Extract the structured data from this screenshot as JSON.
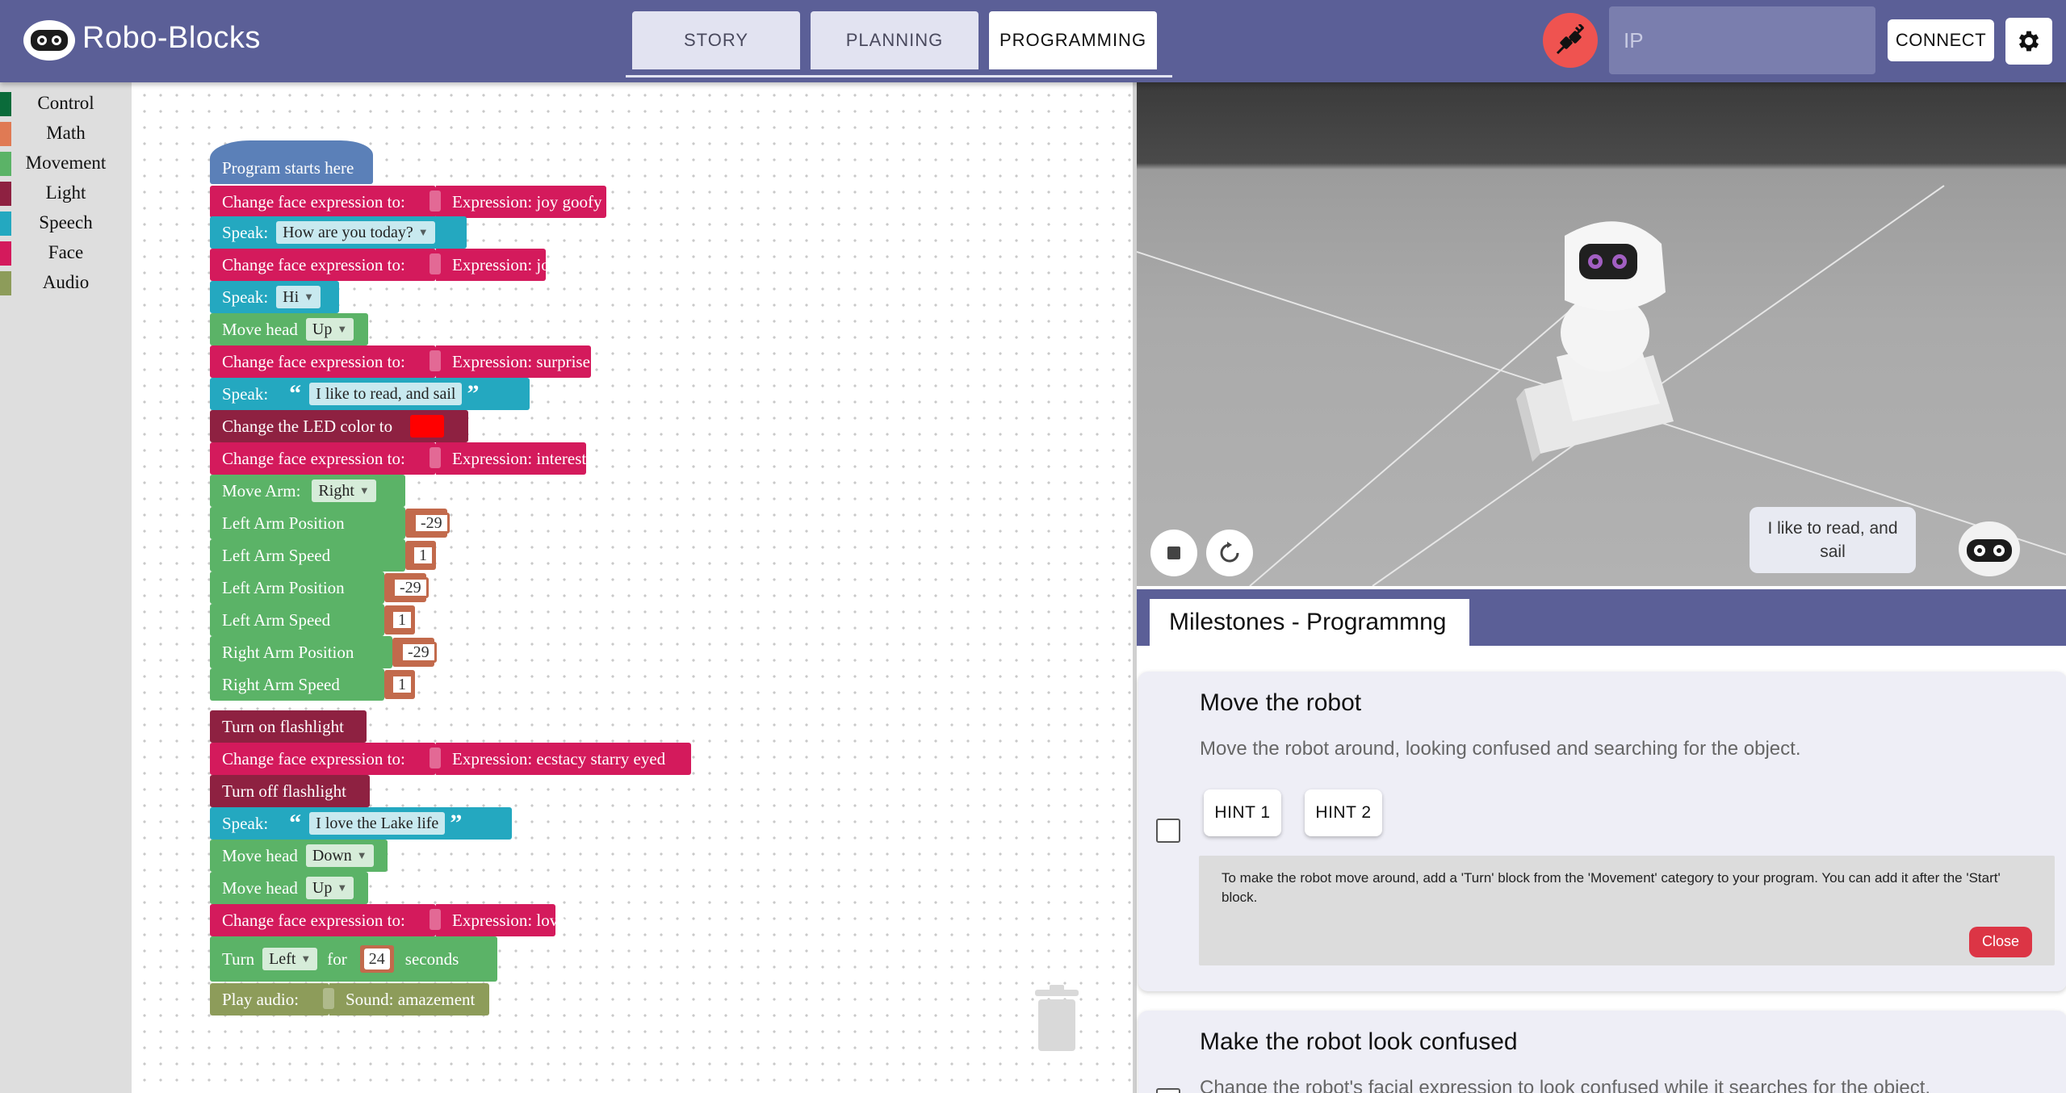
{
  "app": {
    "title": "Robo-Blocks"
  },
  "tabs": [
    {
      "label": "STORY",
      "active": false
    },
    {
      "label": "PLANNING",
      "active": false
    },
    {
      "label": "PROGRAMMING",
      "active": true
    }
  ],
  "connection": {
    "status_icon": "unplugged-icon",
    "ip_placeholder": "IP",
    "connect_label": "CONNECT",
    "settings_icon": "gear-icon"
  },
  "toolbox": {
    "categories": [
      {
        "label": "Control",
        "color": "#0a6b3a"
      },
      {
        "label": "Math",
        "color": "#e07a54"
      },
      {
        "label": "Movement",
        "color": "#5bb367"
      },
      {
        "label": "Light",
        "color": "#8e2141"
      },
      {
        "label": "Speech",
        "color": "#24a8c0"
      },
      {
        "label": "Face",
        "color": "#d41a5c"
      },
      {
        "label": "Audio",
        "color": "#8d9c5a"
      }
    ]
  },
  "program": {
    "start": "Program starts here",
    "b1": {
      "label": "Change face expression to:",
      "value": "Expression: joy goofy"
    },
    "b2": {
      "label": "Speak:",
      "value": "How are you today?"
    },
    "b3": {
      "label": "Change face expression to:",
      "value": "Expression: joy"
    },
    "b4": {
      "label": "Speak:",
      "value": "Hi"
    },
    "b5": {
      "label": "Move head",
      "value": "Up"
    },
    "b6": {
      "label": "Change face expression to:",
      "value": "Expression: surprise"
    },
    "b7": {
      "label": "Speak:",
      "value": "I like to read, and sail"
    },
    "b8": {
      "label": "Change the LED color to",
      "color": "#ff0000"
    },
    "b9": {
      "label": "Change face expression to:",
      "value": "Expression: interest"
    },
    "arm": {
      "label": "Move Arm:",
      "value": "Right",
      "params": [
        {
          "label": "Left Arm Position",
          "value": "-29"
        },
        {
          "label": "Left Arm Speed",
          "value": "1"
        },
        {
          "label": "Left Arm Position",
          "value": "-29"
        },
        {
          "label": "Left Arm Speed",
          "value": "1"
        },
        {
          "label": "Right Arm Position",
          "value": "-29"
        },
        {
          "label": "Right Arm Speed",
          "value": "1"
        }
      ]
    },
    "b10": {
      "label": "Turn on flashlight"
    },
    "b11": {
      "label": "Change face expression to:",
      "value": "Expression: ecstacy starry eyed"
    },
    "b12": {
      "label": "Turn off flashlight"
    },
    "b13": {
      "label": "Speak:",
      "value": "I love the Lake life"
    },
    "b14": {
      "label": "Move head",
      "value": "Down"
    },
    "b15": {
      "label": "Move head",
      "value": "Up"
    },
    "b16": {
      "label": "Change face expression to:",
      "value": "Expression: love"
    },
    "b17": {
      "label_turn": "Turn",
      "direction": "Left",
      "label_for": "for",
      "duration": "24",
      "label_seconds": "seconds"
    },
    "b18": {
      "label": "Play audio:",
      "value": "Sound: amazement"
    }
  },
  "viewport": {
    "speech_bubble": "I like to read, and sail",
    "stop_icon": "stop-icon",
    "reset_icon": "reset-icon"
  },
  "milestones": {
    "tab_label": "Milestones - Programmng",
    "items": [
      {
        "title": "Move the robot",
        "description": "Move the robot around, looking confused and searching for the object.",
        "checked": false,
        "hints": [
          "HINT 1",
          "HINT 2"
        ],
        "hint_text": "To make the robot move around, add a 'Turn' block from the 'Movement' category to your program. You can add it after the 'Start' block.",
        "close_label": "Close"
      },
      {
        "title": "Make the robot look confused",
        "description": "Change the robot's facial expression to look confused while it searches for the object.",
        "checked": false
      }
    ]
  }
}
